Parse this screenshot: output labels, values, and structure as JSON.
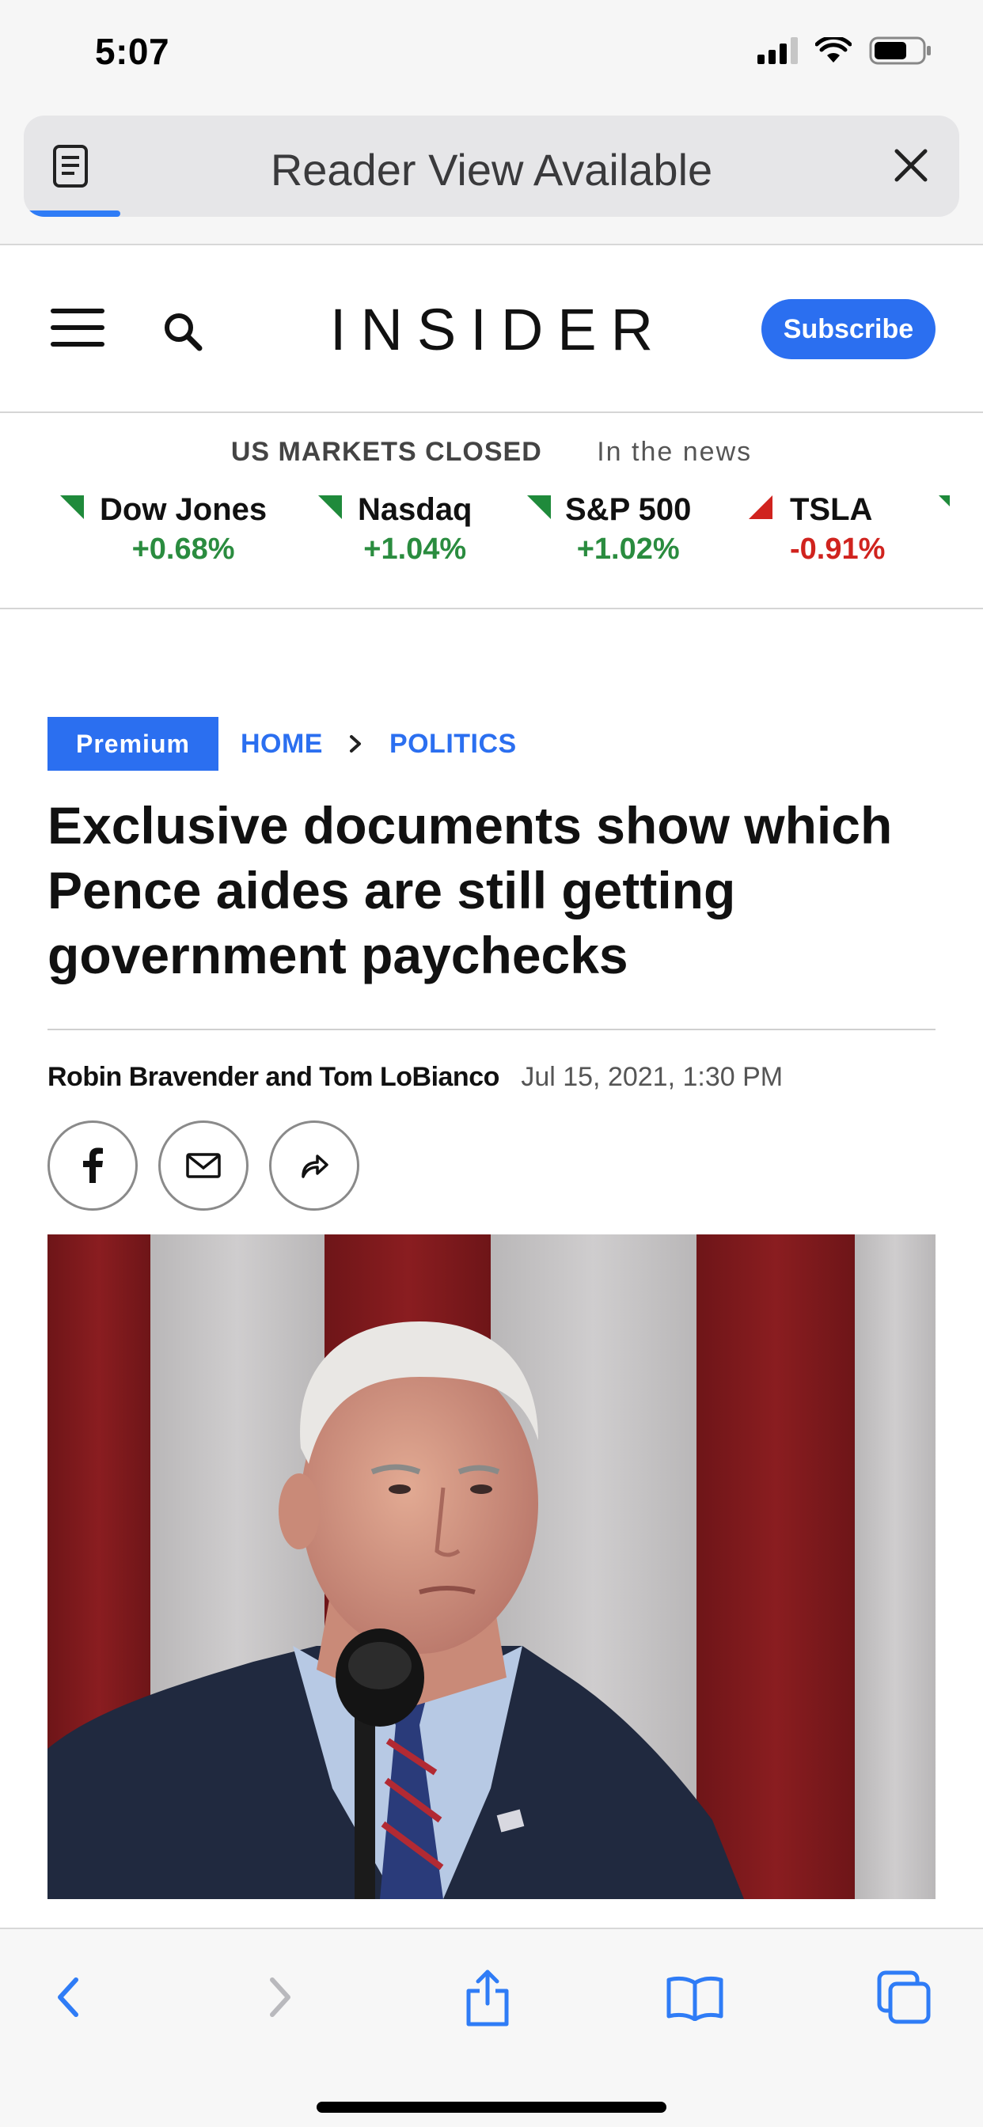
{
  "status_bar": {
    "time": "5:07"
  },
  "reader_bar": {
    "label": "Reader View Available"
  },
  "site": {
    "logo": "INSIDER",
    "subscribe_label": "Subscribe"
  },
  "markets": {
    "status": "US MARKETS CLOSED",
    "in_the_news": "In the news",
    "tickers": [
      {
        "name": "Dow Jones",
        "change": "+0.68%",
        "direction": "up"
      },
      {
        "name": "Nasdaq",
        "change": "+1.04%",
        "direction": "up"
      },
      {
        "name": "S&P 500",
        "change": "+1.02%",
        "direction": "up"
      },
      {
        "name": "TSLA",
        "change": "-0.91%",
        "direction": "down"
      }
    ],
    "colors": {
      "up": "#2a8c3f",
      "down": "#d0231e"
    }
  },
  "article": {
    "badge": "Premium",
    "breadcrumb": [
      "HOME",
      "POLITICS"
    ],
    "headline": "Exclusive documents show which Pence aides are still getting government paychecks",
    "authors": "Robin Bravender and Tom LoBianco",
    "date": "Jul 15, 2021, 1:30 PM",
    "share_buttons": [
      "facebook-icon",
      "email-icon",
      "share-icon"
    ]
  },
  "toolbar": {
    "buttons": [
      "back-icon",
      "forward-icon",
      "share-icon",
      "bookmarks-icon",
      "tabs-icon"
    ]
  },
  "accent_color": "#2b6ff0"
}
